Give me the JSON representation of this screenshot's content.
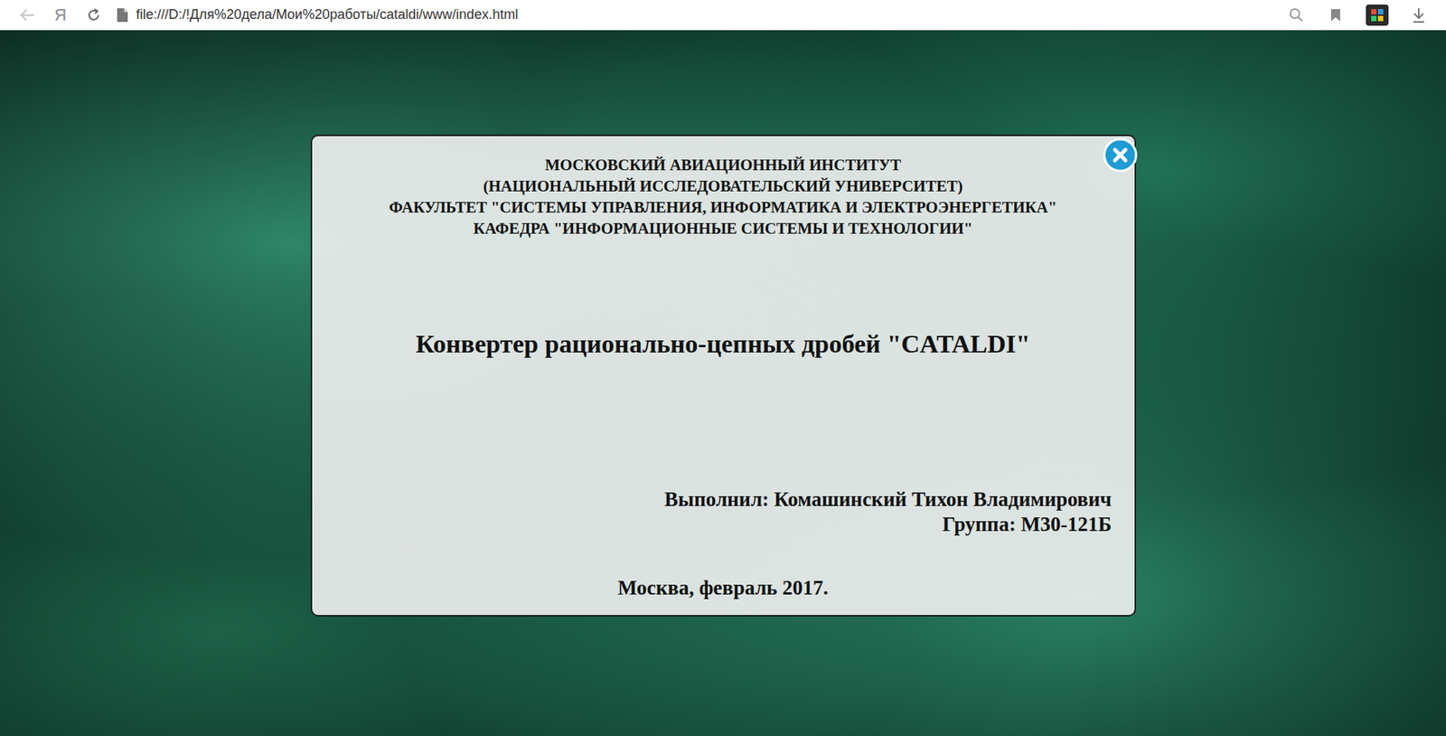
{
  "browser": {
    "logo": "Я",
    "address": "file:///D:/!Для%20дела/Мои%20работы/cataldi/www/index.html"
  },
  "dialog": {
    "header": [
      "МОСКОВСКИЙ АВИАЦИОННЫЙ ИНСТИТУТ",
      "(НАЦИОНАЛЬНЫЙ ИССЛЕДОВАТЕЛЬСКИЙ УНИВЕРСИТЕТ)",
      "ФАКУЛЬТЕТ \"СИСТЕМЫ УПРАВЛЕНИЯ, ИНФОРМАТИКА И ЭЛЕКТРОЭНЕРГЕТИКА\"",
      "КАФЕДРА \"ИНФОРМАЦИОННЫЕ СИСТЕМЫ И ТЕХНОЛОГИИ\""
    ],
    "title": "Конвертер рационально-цепных дробей \"CATALDI\"",
    "author": [
      "Выполнил: Комашинский Тихон Владимирович",
      "Группа: М30-121Б"
    ],
    "footer": "Москва, февраль 2017."
  }
}
